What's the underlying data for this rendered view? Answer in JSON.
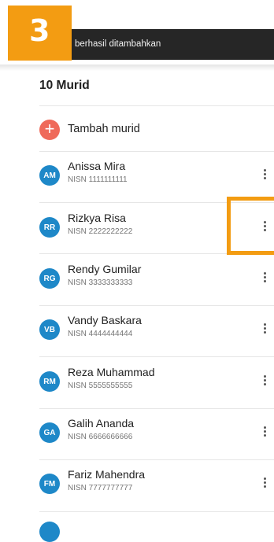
{
  "step_badge": "3",
  "toast": {
    "message": "berhasil ditambahkan"
  },
  "list": {
    "title": "10 Murid",
    "add_label": "Tambah murid",
    "nisn_prefix": "NISN",
    "students": [
      {
        "initials": "AM",
        "name": "Anissa Mira",
        "nisn": "NISN 1111111111"
      },
      {
        "initials": "RR",
        "name": "Rizkya Risa",
        "nisn": "NISN 2222222222"
      },
      {
        "initials": "RG",
        "name": "Rendy Gumilar",
        "nisn": "NISN 3333333333"
      },
      {
        "initials": "VB",
        "name": "Vandy Baskara",
        "nisn": "NISN 4444444444"
      },
      {
        "initials": "RM",
        "name": "Reza Muhammad",
        "nisn": "NISN 5555555555"
      },
      {
        "initials": "GA",
        "name": "Galih Ananda",
        "nisn": "NISN 6666666666"
      },
      {
        "initials": "FM",
        "name": "Fariz Mahendra",
        "nisn": "NISN 7777777777"
      }
    ]
  },
  "colors": {
    "accent": "#f39c12",
    "avatar": "#1e88c8",
    "add_button": "#ef6a5a",
    "toast_bg": "#262626"
  },
  "icons": {
    "more": "more-vert-icon",
    "add": "plus-icon"
  }
}
